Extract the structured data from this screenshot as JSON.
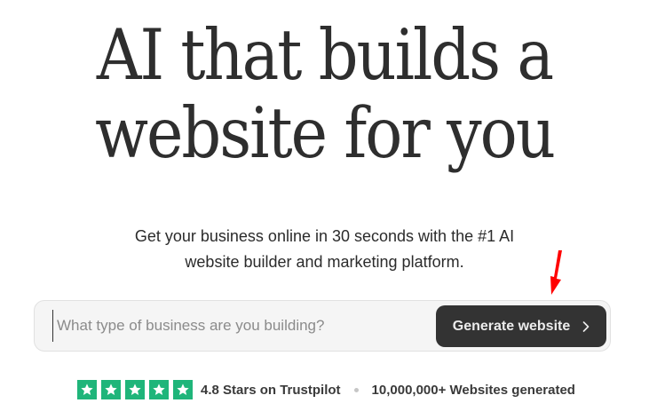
{
  "hero": {
    "title_line_1": "AI that builds a",
    "title_line_2": "website for you",
    "subtitle_line_1": "Get your business online in 30 seconds with the #1 AI",
    "subtitle_line_2": "website builder and marketing platform."
  },
  "search": {
    "placeholder": "What type of business are you building?",
    "button_label": "Generate website"
  },
  "trust": {
    "star_count": 5,
    "rating_text": "4.8 Stars on Trustpilot",
    "websites_text": "10,000,000+ Websites generated"
  },
  "colors": {
    "star_green": "#1fb57a",
    "button_dark": "#333333",
    "arrow_red": "#ff0000"
  },
  "icons": {
    "button_icon": "chevron-right-icon",
    "star_icon": "star-icon",
    "annotation": "red-arrow-icon"
  }
}
